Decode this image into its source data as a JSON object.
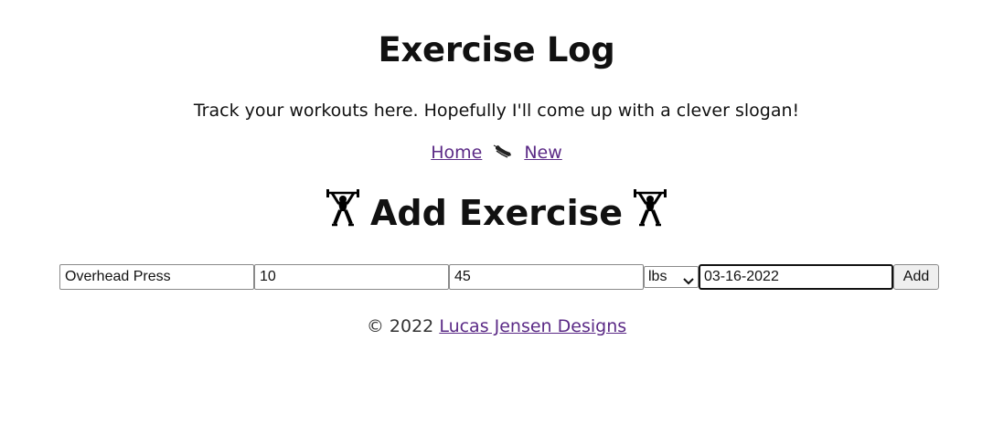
{
  "header": {
    "title": "Exercise Log",
    "slogan": "Track your workouts here. Hopefully I'll come up with a clever slogan!"
  },
  "nav": {
    "home_label": "Home",
    "separator_icon": "running-shoe-icon",
    "new_label": "New"
  },
  "main": {
    "heading": "Add Exercise",
    "heading_icon": "weightlifter-icon",
    "form": {
      "name_value": "Overhead Press",
      "reps_value": "10",
      "weight_value": "45",
      "unit_selected": "lbs",
      "date_value": "03-16-2022",
      "submit_label": "Add"
    }
  },
  "footer": {
    "copyright": "© 2022",
    "link_label": "Lucas Jensen Designs"
  },
  "colors": {
    "link": "#5b2a86",
    "text": "#111111"
  }
}
